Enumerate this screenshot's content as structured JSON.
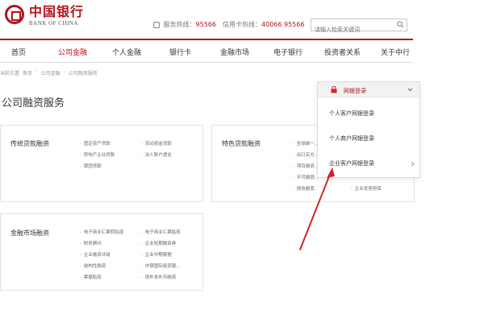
{
  "header": {
    "logo_cn": "中国银行",
    "logo_en": "BANK OF CHINA",
    "service_hotline_label": "服务热线：",
    "service_hotline": "95566",
    "card_hotline_label": "信用卡热线：",
    "card_hotline": "40066 95566",
    "search_placeholder": "请输入检索关键词"
  },
  "nav": {
    "items": [
      "首页",
      "公司金融",
      "个人金融",
      "银行卡",
      "金融市场",
      "电子银行",
      "投资者关系",
      "关于中行"
    ],
    "active": "公司金融"
  },
  "breadcrumb": {
    "items": [
      "当前位置",
      "首页",
      "公司金融",
      "公司融资服务"
    ]
  },
  "page_title": "公司融资服务",
  "login": {
    "title": "网银登录",
    "items": [
      "个人客户网银登录",
      "个人商户网银登录",
      "企业客户网银登录"
    ]
  },
  "cards": {
    "traditional": {
      "title": "传统贷款融资",
      "col1": [
        "固定资产贷款",
        "房地产企业贷款",
        "银团贷款"
      ],
      "col2": [
        "流动资金贷款",
        "法人账户透支"
      ]
    },
    "special": {
      "title": "特色贷款融资",
      "col1": [
        "全球统一…",
        "出口买方…",
        "项目融资…",
        "不可撤销…",
        "授信额度…"
      ],
      "col2": [
        "企业发债担保"
      ]
    },
    "market": {
      "title": "金融市场融资",
      "col1": [
        "电子商业汇票转贴现",
        "财务顾问",
        "企业融资评级",
        "结构性融资",
        "票据贴现"
      ],
      "col2": [
        "电子商业汇票贴现",
        "企业短期融资券",
        "企业中期票据",
        "中银国际投资银…",
        "境外本外币融资"
      ]
    }
  },
  "colors": {
    "brand_red": "#b5121b"
  }
}
